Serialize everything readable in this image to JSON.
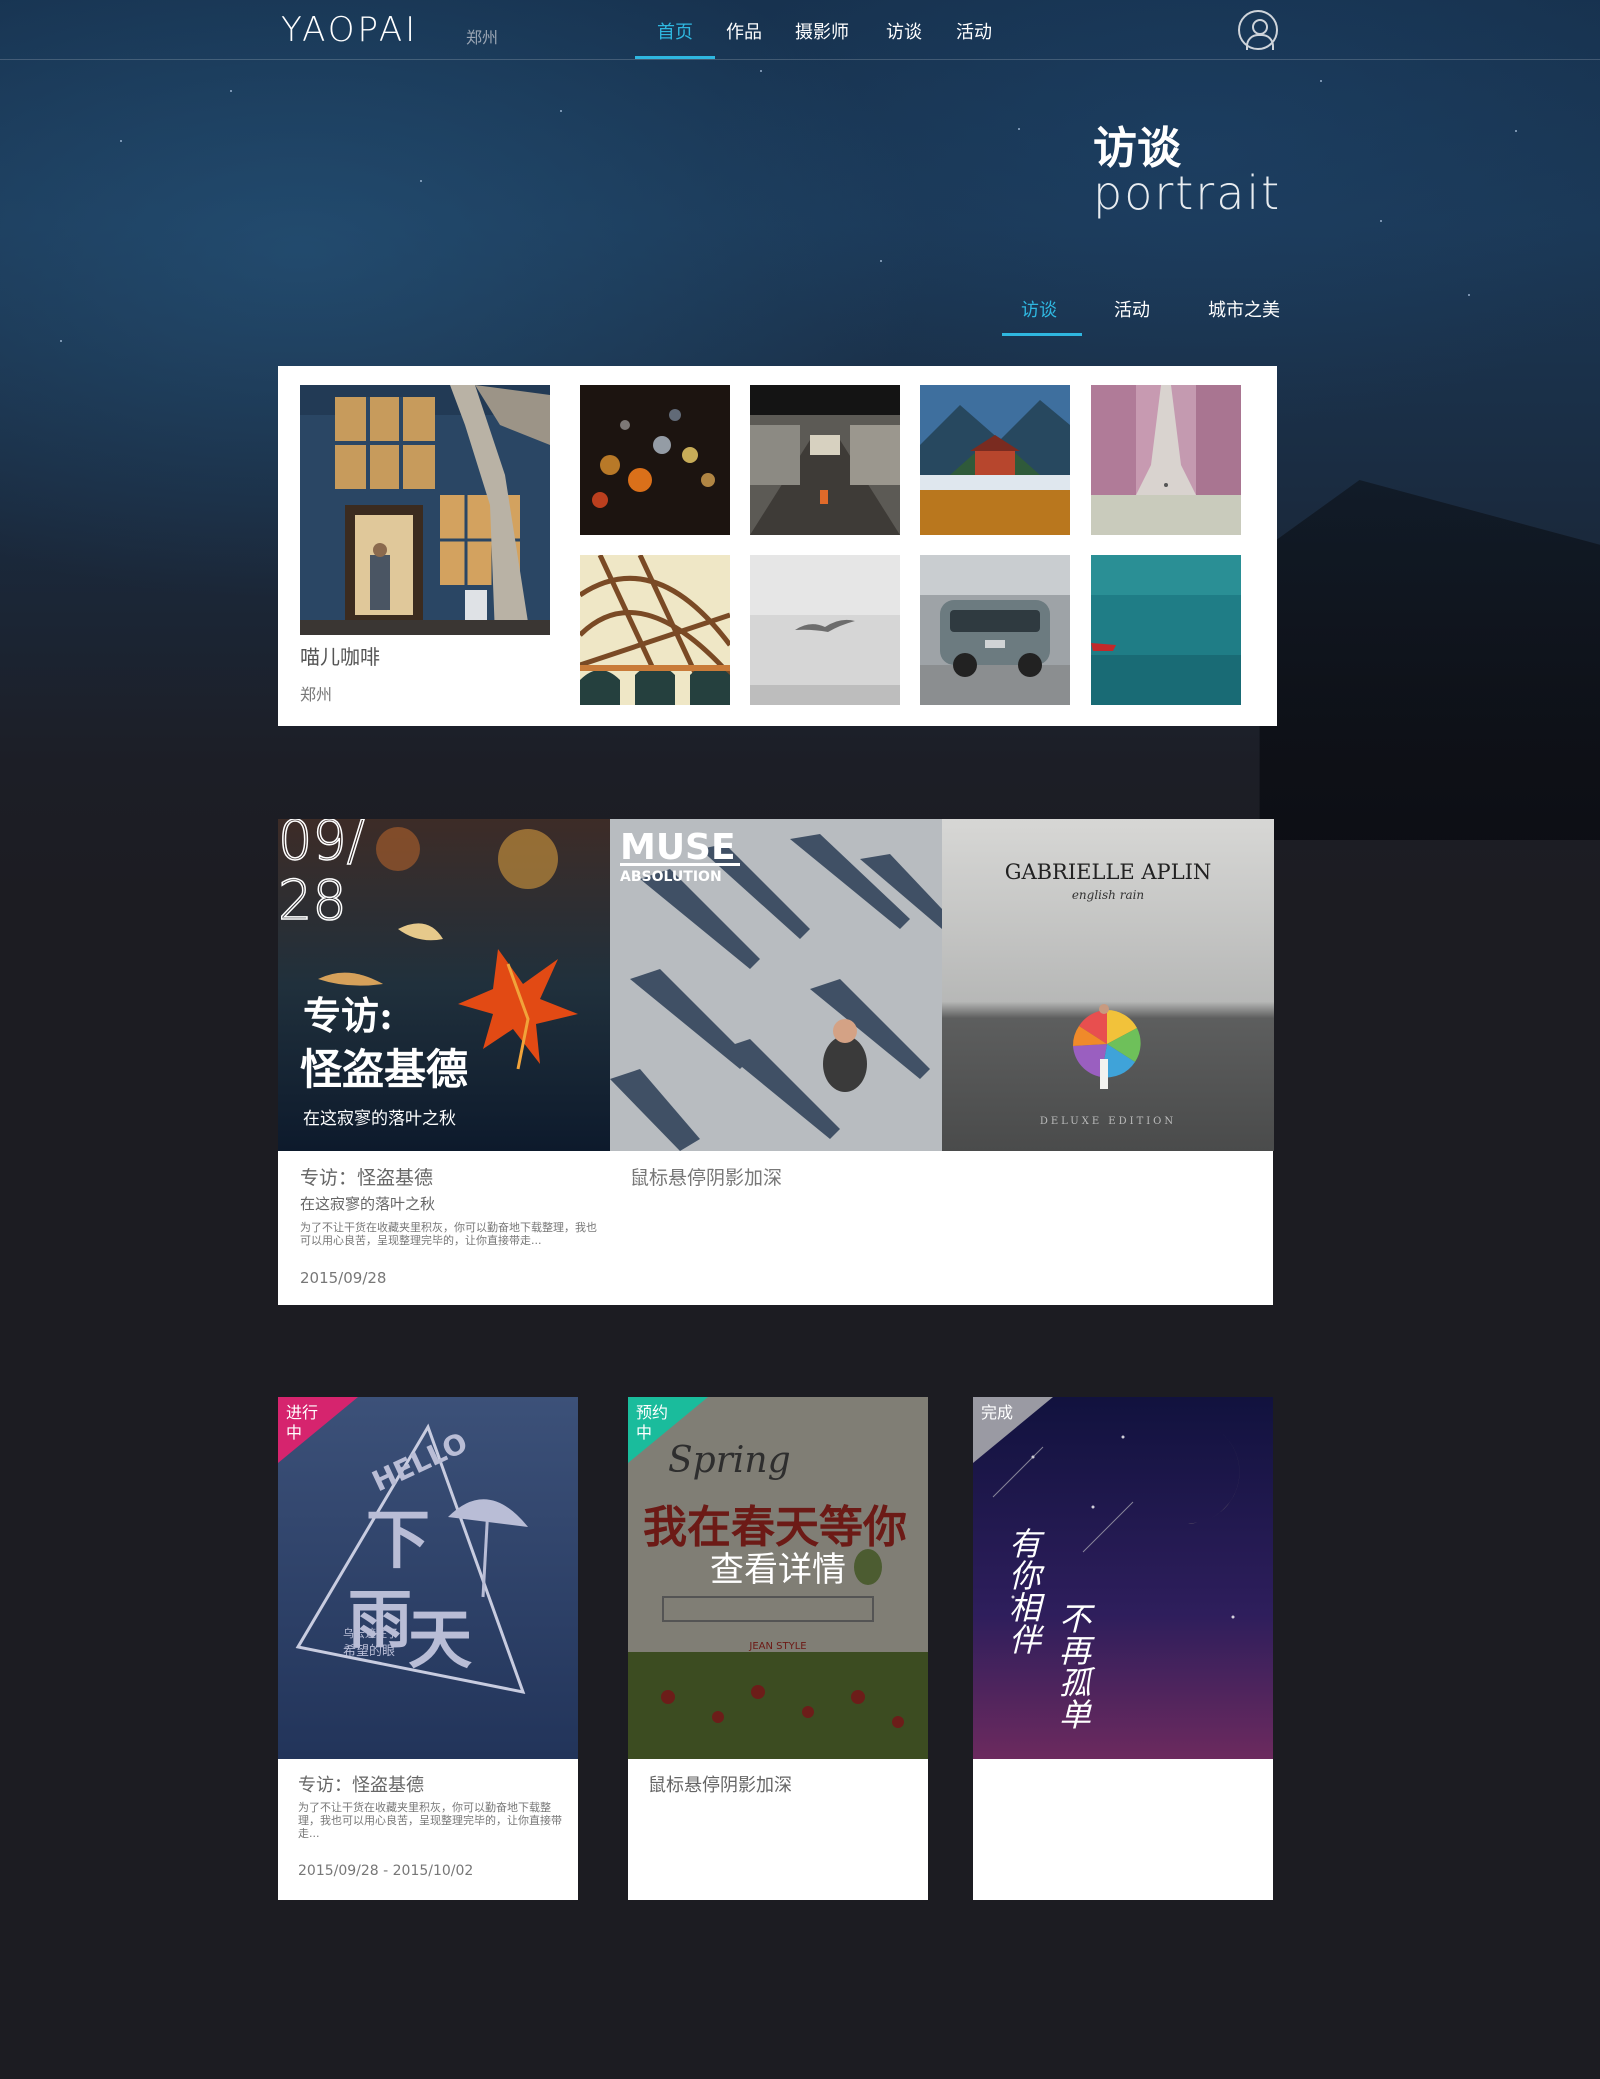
{
  "nav": {
    "logo": "YAOPAI",
    "city": "郑州",
    "items": [
      "首页",
      "作品",
      "摄影师",
      "访谈",
      "活动"
    ],
    "active_index": 0
  },
  "section": {
    "title_cn": "访谈",
    "title_en": "portrait"
  },
  "sub_tabs": [
    "访谈",
    "活动",
    "城市之美"
  ],
  "gallery": {
    "feature_name": "喵儿咖啡",
    "feature_city": "郑州"
  },
  "interviews": {
    "date_overlay": [
      "09/",
      "28"
    ],
    "poster_title": "专访:",
    "poster_name": "怪盗基德",
    "poster_sub": "在这寂寥的落叶之秋",
    "album1_band": "MUSE",
    "album1_title": "ABSOLUTION",
    "album2_artist": "GABRIELLE APLIN",
    "album2_title": "english rain",
    "album2_edition": "DELUXE EDITION",
    "card_title": "专访：怪盗基德",
    "card_sub": "在这寂寥的落叶之秋",
    "card_desc": "为了不让干货在收藏夹里积灰，你可以勤奋地下载整理，我也可以用心良苦，呈现整理完毕的，让你直接带走...",
    "card_date": "2015/09/28",
    "hover_hint": "鼠标悬停阴影加深"
  },
  "activities": [
    {
      "status": "进行中",
      "status_color": "#d6246e",
      "poster_lines": [
        "HELLO",
        "下",
        "雨",
        "天",
        "乌云遮住了",
        "希望的眼"
      ],
      "title": "专访：怪盗基德",
      "desc": "为了不让干货在收藏夹里积灰，你可以勤奋地下载整理，我也可以用心良苦，呈现整理完毕的，让你直接带走...",
      "date": "2015/09/28 - 2015/10/02"
    },
    {
      "status": "预约中",
      "status_color": "#1abc9c",
      "poster_lines": [
        "Spring",
        "我在春天等你",
        "JEAN STYLE"
      ],
      "detail_label": "查看详情",
      "hover_hint": "鼠标悬停阴影加深"
    },
    {
      "status": "完成",
      "status_color": "#9a9aa3",
      "poster_lines": [
        "有你相伴",
        "不再孤单"
      ]
    }
  ]
}
